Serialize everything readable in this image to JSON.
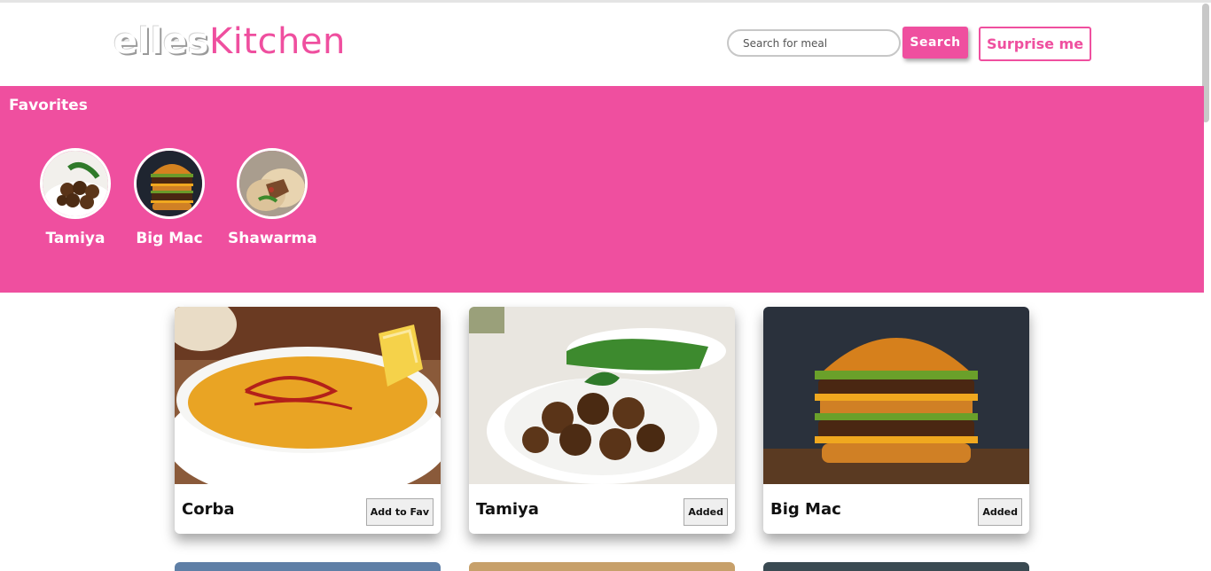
{
  "header": {
    "logo_part1": "elles",
    "logo_part2": "Kitchen",
    "search_placeholder": "Search for meal",
    "search_label": "Search",
    "surprise_label": "Surprise me"
  },
  "favorites": {
    "title": "Favorites",
    "items": [
      {
        "name": "Tamiya"
      },
      {
        "name": "Big Mac"
      },
      {
        "name": "Shawarma"
      }
    ]
  },
  "meals": [
    {
      "name": "Corba",
      "button": "Add to Fav"
    },
    {
      "name": "Tamiya",
      "button": "Added"
    },
    {
      "name": "Big Mac",
      "button": "Added"
    }
  ],
  "colors": {
    "accent": "#ef4f9f"
  }
}
